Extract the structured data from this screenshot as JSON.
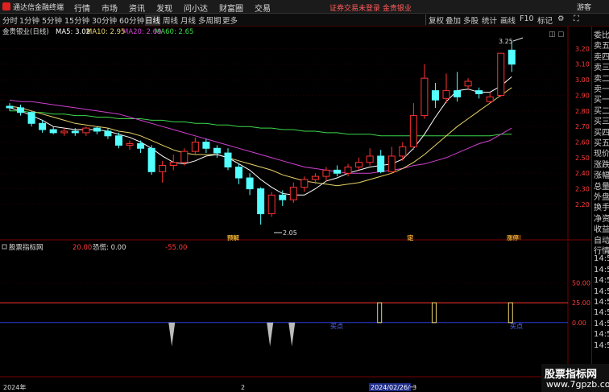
{
  "app": {
    "title": "通达信金融终端",
    "guest": "游客",
    "notice": "证券交易未登录  金贵银业"
  },
  "menu": [
    "行情",
    "市场",
    "资讯",
    "发现",
    "问小达",
    "财富圈",
    "交易"
  ],
  "periods": [
    "分时",
    "1分钟",
    "5分钟",
    "15分钟",
    "30分钟",
    "60分钟",
    "日线",
    "周线",
    "月线",
    "多周期",
    "更多"
  ],
  "active_period": "日线",
  "right_tools": [
    "复权",
    "叠加",
    "多股",
    "统计",
    "画线",
    "F10",
    "标记"
  ],
  "right_icons": {
    "settings": "gear-icon",
    "fullscreen": "fullscreen-icon"
  },
  "main_legend": {
    "name": "金贵银业(日线)",
    "ma5": "MA5: 3.02",
    "ma10": "MA10: 2.95",
    "ma20": "MA20: 2.69",
    "ma60": "MA60: 2.65"
  },
  "colors": {
    "up": "#ff3232",
    "down": "#54ffff",
    "ma5": "#ffffff",
    "ma10": "#e8d36a",
    "ma20": "#d040d0",
    "ma60": "#3cd84c",
    "grid": "#7a0000"
  },
  "annotations": {
    "high": "3.25",
    "low": "2.05"
  },
  "events": [
    "预解",
    "定",
    "涨停"
  ],
  "indicator": {
    "name": "股票指标网",
    "v1": "20.00",
    "v2": "恐慌: 0.00",
    "v3": "-55.00",
    "mark1": "买点",
    "mark2": "买点"
  },
  "date_bar": {
    "year": "2024年",
    "mid": "2",
    "date": "2024/02/26/一",
    "end": "3"
  },
  "right_panel": [
    "委比",
    "卖五",
    "卖四",
    "卖三",
    "卖二",
    "卖一",
    "买一",
    "买二",
    "买三",
    "买四",
    "买五",
    "现价",
    "涨跌",
    "涨幅",
    "总量",
    "外盘",
    "换手",
    "净资",
    "收益",
    "自动",
    "行情",
    "14:56",
    "14:56",
    "14:56",
    "14:56",
    "14:56",
    "14:56",
    "14:56",
    "14:56",
    "14:56"
  ],
  "watermark": {
    "line1": "股票指标网",
    "line2": "www.7gpzb.com"
  },
  "chart_data": {
    "type": "candlestick",
    "ylim": [
      2.05,
      3.3
    ],
    "yticks": [
      "3.20",
      "3.10",
      "3.00",
      "2.90",
      "2.80",
      "2.70",
      "2.60",
      "2.50",
      "2.40",
      "2.30",
      "2.20"
    ],
    "candles": [
      [
        2.83,
        2.82,
        2.85,
        2.8
      ],
      [
        2.82,
        2.79,
        2.84,
        2.77
      ],
      [
        2.79,
        2.72,
        2.8,
        2.7
      ],
      [
        2.72,
        2.68,
        2.74,
        2.66
      ],
      [
        2.68,
        2.66,
        2.7,
        2.65
      ],
      [
        2.66,
        2.67,
        2.69,
        2.64
      ],
      [
        2.67,
        2.66,
        2.69,
        2.64
      ],
      [
        2.66,
        2.69,
        2.7,
        2.64
      ],
      [
        2.69,
        2.67,
        2.7,
        2.65
      ],
      [
        2.67,
        2.64,
        2.69,
        2.62
      ],
      [
        2.64,
        2.58,
        2.66,
        2.56
      ],
      [
        2.58,
        2.59,
        2.61,
        2.55
      ],
      [
        2.59,
        2.56,
        2.61,
        2.53
      ],
      [
        2.56,
        2.41,
        2.58,
        2.39
      ],
      [
        2.41,
        2.45,
        2.48,
        2.34
      ],
      [
        2.45,
        2.47,
        2.52,
        2.42
      ],
      [
        2.47,
        2.54,
        2.56,
        2.45
      ],
      [
        2.54,
        2.6,
        2.63,
        2.52
      ],
      [
        2.6,
        2.56,
        2.62,
        2.53
      ],
      [
        2.56,
        2.53,
        2.58,
        2.5
      ],
      [
        2.53,
        2.44,
        2.56,
        2.42
      ],
      [
        2.44,
        2.37,
        2.46,
        2.33
      ],
      [
        2.37,
        2.3,
        2.4,
        2.26
      ],
      [
        2.3,
        2.14,
        2.31,
        2.07
      ],
      [
        2.14,
        2.26,
        2.28,
        2.12
      ],
      [
        2.26,
        2.23,
        2.29,
        2.19
      ],
      [
        2.23,
        2.31,
        2.34,
        2.21
      ],
      [
        2.31,
        2.36,
        2.38,
        2.28
      ],
      [
        2.36,
        2.38,
        2.4,
        2.33
      ],
      [
        2.38,
        2.42,
        2.44,
        2.35
      ],
      [
        2.42,
        2.4,
        2.45,
        2.38
      ],
      [
        2.4,
        2.44,
        2.46,
        2.38
      ],
      [
        2.44,
        2.47,
        2.5,
        2.42
      ],
      [
        2.47,
        2.51,
        2.56,
        2.45
      ],
      [
        2.51,
        2.41,
        2.55,
        2.4
      ],
      [
        2.41,
        2.51,
        2.57,
        2.4
      ],
      [
        2.51,
        2.57,
        2.6,
        2.48
      ],
      [
        2.57,
        2.77,
        2.85,
        2.55
      ],
      [
        2.77,
        3.01,
        3.1,
        2.75
      ],
      [
        2.93,
        2.87,
        2.98,
        2.82
      ],
      [
        2.88,
        2.93,
        3.04,
        2.85
      ],
      [
        2.93,
        2.89,
        3.05,
        2.86
      ],
      [
        2.96,
        2.99,
        3.01,
        2.94
      ],
      [
        2.93,
        2.91,
        2.95,
        2.88
      ],
      [
        2.86,
        2.89,
        2.92,
        2.85
      ],
      [
        2.9,
        3.17,
        3.17,
        2.89
      ],
      [
        3.19,
        3.1,
        3.25,
        3.05
      ]
    ],
    "ma5": [
      2.82,
      2.8,
      2.77,
      2.74,
      2.7,
      2.69,
      2.68,
      2.68,
      2.68,
      2.67,
      2.65,
      2.63,
      2.6,
      2.56,
      2.51,
      2.47,
      2.46,
      2.48,
      2.51,
      2.52,
      2.5,
      2.46,
      2.42,
      2.36,
      2.31,
      2.27,
      2.26,
      2.26,
      2.3,
      2.35,
      2.37,
      2.4,
      2.42,
      2.44,
      2.45,
      2.46,
      2.49,
      2.56,
      2.65,
      2.76,
      2.86,
      2.93,
      2.94,
      2.92,
      2.92,
      2.96,
      3.02
    ],
    "ma10": [
      2.83,
      2.82,
      2.8,
      2.78,
      2.76,
      2.74,
      2.72,
      2.71,
      2.7,
      2.69,
      2.67,
      2.66,
      2.64,
      2.61,
      2.58,
      2.55,
      2.53,
      2.52,
      2.52,
      2.52,
      2.5,
      2.48,
      2.46,
      2.44,
      2.42,
      2.39,
      2.37,
      2.35,
      2.34,
      2.33,
      2.32,
      2.33,
      2.34,
      2.36,
      2.38,
      2.4,
      2.43,
      2.47,
      2.52,
      2.58,
      2.64,
      2.7,
      2.75,
      2.8,
      2.85,
      2.9,
      2.95
    ],
    "ma20": [
      2.87,
      2.86,
      2.86,
      2.85,
      2.84,
      2.83,
      2.82,
      2.81,
      2.8,
      2.79,
      2.78,
      2.76,
      2.74,
      2.72,
      2.7,
      2.68,
      2.66,
      2.64,
      2.62,
      2.6,
      2.58,
      2.56,
      2.54,
      2.52,
      2.5,
      2.48,
      2.46,
      2.44,
      2.43,
      2.42,
      2.41,
      2.4,
      2.4,
      2.4,
      2.41,
      2.42,
      2.43,
      2.45,
      2.46,
      2.48,
      2.5,
      2.53,
      2.56,
      2.59,
      2.61,
      2.65,
      2.69
    ],
    "ma60": [
      2.8,
      2.8,
      2.79,
      2.79,
      2.78,
      2.78,
      2.77,
      2.77,
      2.76,
      2.76,
      2.75,
      2.75,
      2.75,
      2.74,
      2.74,
      2.73,
      2.73,
      2.72,
      2.72,
      2.71,
      2.71,
      2.7,
      2.7,
      2.69,
      2.69,
      2.68,
      2.68,
      2.67,
      2.67,
      2.66,
      2.66,
      2.65,
      2.65,
      2.65,
      2.64,
      2.64,
      2.64,
      2.64,
      2.64,
      2.64,
      2.64,
      2.64,
      2.64,
      2.64,
      2.64,
      2.65,
      2.65
    ],
    "indicator": {
      "yticks": [
        "50.00",
        "25.00",
        "0.00"
      ],
      "ylim": [
        -60,
        90
      ],
      "buy_bars": [
        34,
        39,
        46
      ],
      "low_bars": [
        15,
        24,
        26
      ]
    }
  }
}
